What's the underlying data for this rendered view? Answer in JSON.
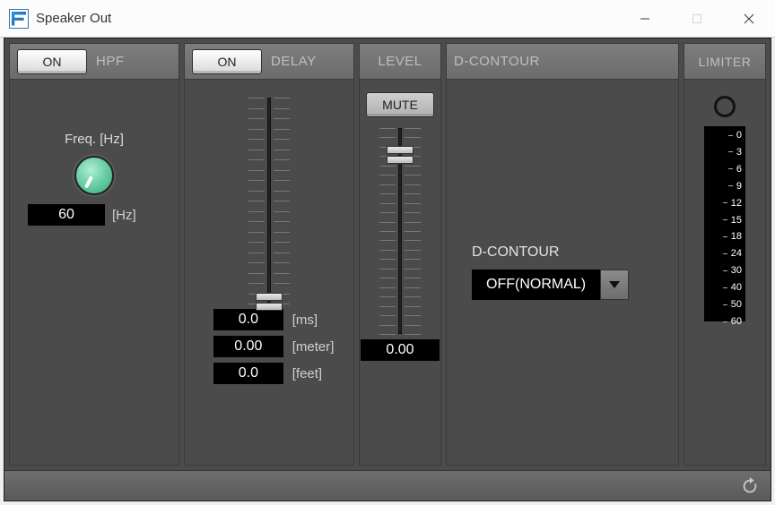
{
  "window": {
    "title": "Speaker Out"
  },
  "hpf": {
    "header": "HPF",
    "on": "ON",
    "freq_label": "Freq. [Hz]",
    "value": "60",
    "unit": "[Hz]"
  },
  "delay": {
    "header": "DELAY",
    "on": "ON",
    "ms": {
      "value": "0.0",
      "unit": "[ms]"
    },
    "meter": {
      "value": "0.00",
      "unit": "[meter]"
    },
    "feet": {
      "value": "0.0",
      "unit": "[feet]"
    }
  },
  "level": {
    "header": "LEVEL",
    "mute": "MUTE",
    "value": "0.00"
  },
  "dcontour": {
    "header": "D-CONTOUR",
    "label": "D-CONTOUR",
    "value": "OFF(NORMAL)"
  },
  "limiter": {
    "header": "LIMITER",
    "scale": [
      "0",
      "3",
      "6",
      "9",
      "12",
      "15",
      "18",
      "24",
      "30",
      "40",
      "50",
      "60"
    ]
  }
}
